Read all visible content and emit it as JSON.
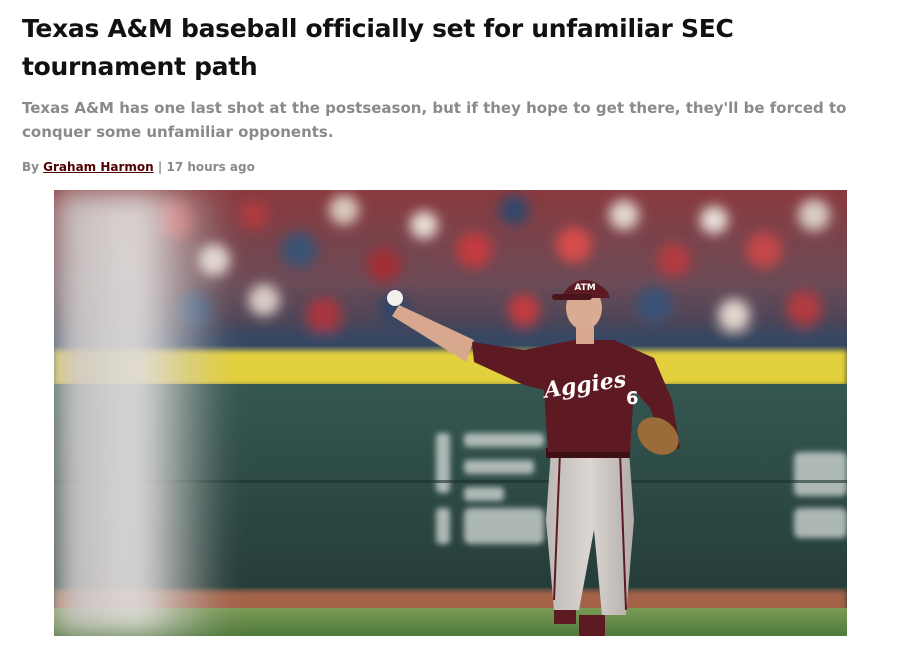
{
  "article": {
    "headline": "Texas A&M baseball officially set for unfamiliar SEC tournament path",
    "dek": "Texas A&M has one last shot at the postseason, but if they hope to get there, they'll be forced to conquer some unfamiliar opponents.",
    "byline": {
      "prefix": "By",
      "author": "Graham Harmon",
      "separator": "|",
      "timestamp": "17 hours ago"
    }
  },
  "hero_image": {
    "jersey_text": "Aggies",
    "jersey_number": "6",
    "cap_logo": "ATM",
    "colors": {
      "maroon": "#5d1a22",
      "wall_green": "#2f4a45",
      "wall_yellow": "#e3d03c"
    }
  }
}
